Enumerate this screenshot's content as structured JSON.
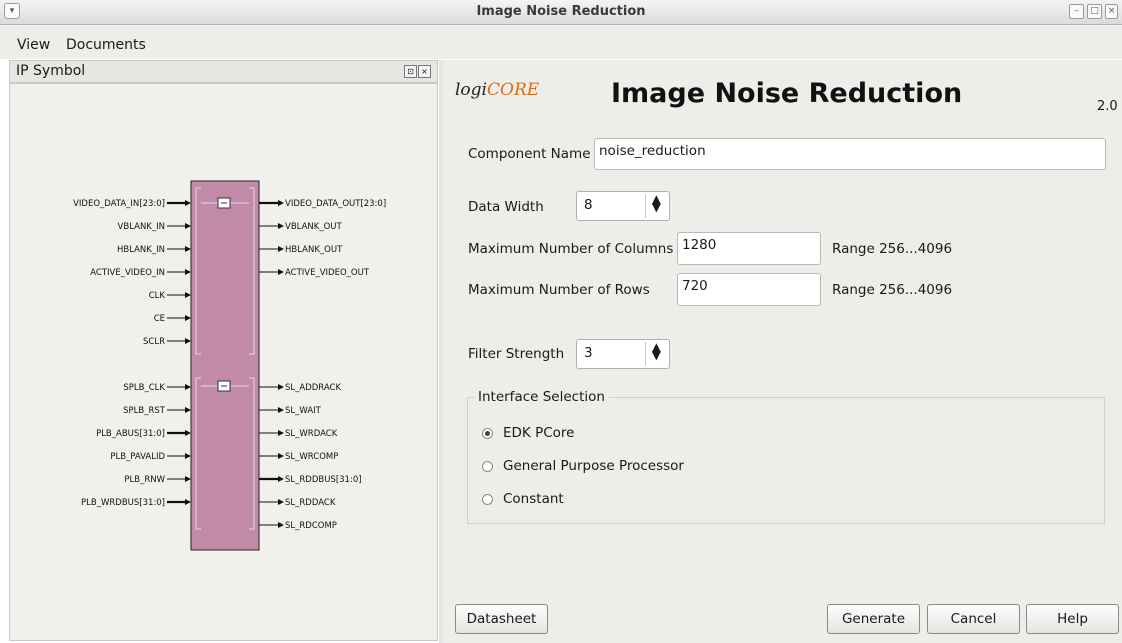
{
  "window": {
    "title": "Image Noise Reduction"
  },
  "menu": {
    "items": [
      "View",
      "Documents"
    ]
  },
  "ip_panel": {
    "title": "IP Symbol",
    "block_color": "#c08aa8",
    "left_pins_top": [
      "VIDEO_DATA_IN[23:0]",
      "VBLANK_IN",
      "HBLANK_IN",
      "ACTIVE_VIDEO_IN",
      "CLK",
      "CE",
      "SCLR"
    ],
    "right_pins_top": [
      "VIDEO_DATA_OUT[23:0]",
      "VBLANK_OUT",
      "HBLANK_OUT",
      "ACTIVE_VIDEO_OUT"
    ],
    "left_pins_bottom": [
      "SPLB_CLK",
      "SPLB_RST",
      "PLB_ABUS[31:0]",
      "PLB_PAVALID",
      "PLB_RNW",
      "PLB_WRDBUS[31:0]"
    ],
    "right_pins_bottom": [
      "SL_ADDRACK",
      "SL_WAIT",
      "SL_WRDACK",
      "SL_WRCOMP",
      "SL_RDDBUS[31:0]",
      "SL_RDDACK",
      "SL_RDCOMP"
    ]
  },
  "form": {
    "logo": {
      "prefix": "logi",
      "suffix": "CORE"
    },
    "heading": "Image Noise Reduction",
    "version": "2.0",
    "component_name_label": "Component Name",
    "component_name": "noise_reduction",
    "data_width_label": "Data Width",
    "data_width": "8",
    "max_columns_label": "Maximum Number of Columns",
    "max_columns": "1280",
    "max_columns_range": "Range 256...4096",
    "max_rows_label": "Maximum Number of Rows",
    "max_rows": "720",
    "max_rows_range": "Range 256...4096",
    "filter_strength_label": "Filter Strength",
    "filter_strength": "3",
    "interface_title": "Interface Selection",
    "interfaces": [
      {
        "label": "EDK PCore",
        "selected": true
      },
      {
        "label": "General Purpose Processor",
        "selected": false
      },
      {
        "label": "Constant",
        "selected": false
      }
    ]
  },
  "buttons": {
    "datasheet": "Datasheet",
    "generate": "Generate",
    "cancel": "Cancel",
    "help": "Help"
  }
}
